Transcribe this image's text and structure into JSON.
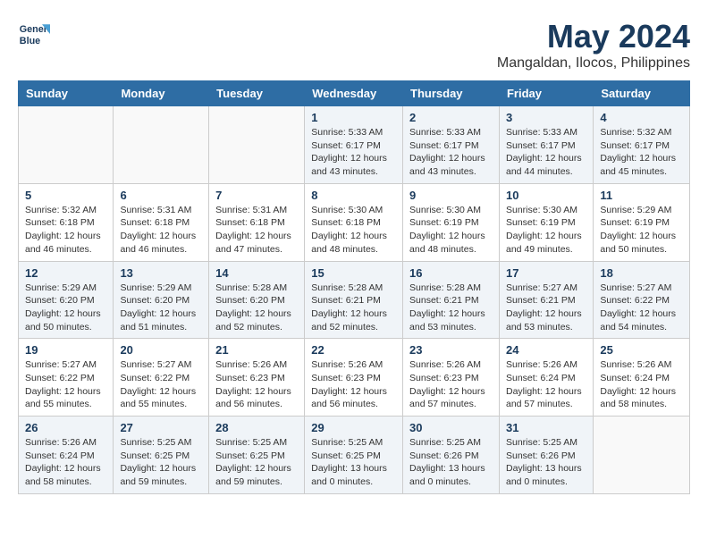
{
  "logo": {
    "line1": "General",
    "line2": "Blue"
  },
  "title": "May 2024",
  "location": "Mangaldan, Ilocos, Philippines",
  "weekdays": [
    "Sunday",
    "Monday",
    "Tuesday",
    "Wednesday",
    "Thursday",
    "Friday",
    "Saturday"
  ],
  "weeks": [
    [
      {
        "day": "",
        "info": ""
      },
      {
        "day": "",
        "info": ""
      },
      {
        "day": "",
        "info": ""
      },
      {
        "day": "1",
        "info": "Sunrise: 5:33 AM\nSunset: 6:17 PM\nDaylight: 12 hours\nand 43 minutes."
      },
      {
        "day": "2",
        "info": "Sunrise: 5:33 AM\nSunset: 6:17 PM\nDaylight: 12 hours\nand 43 minutes."
      },
      {
        "day": "3",
        "info": "Sunrise: 5:33 AM\nSunset: 6:17 PM\nDaylight: 12 hours\nand 44 minutes."
      },
      {
        "day": "4",
        "info": "Sunrise: 5:32 AM\nSunset: 6:17 PM\nDaylight: 12 hours\nand 45 minutes."
      }
    ],
    [
      {
        "day": "5",
        "info": "Sunrise: 5:32 AM\nSunset: 6:18 PM\nDaylight: 12 hours\nand 46 minutes."
      },
      {
        "day": "6",
        "info": "Sunrise: 5:31 AM\nSunset: 6:18 PM\nDaylight: 12 hours\nand 46 minutes."
      },
      {
        "day": "7",
        "info": "Sunrise: 5:31 AM\nSunset: 6:18 PM\nDaylight: 12 hours\nand 47 minutes."
      },
      {
        "day": "8",
        "info": "Sunrise: 5:30 AM\nSunset: 6:18 PM\nDaylight: 12 hours\nand 48 minutes."
      },
      {
        "day": "9",
        "info": "Sunrise: 5:30 AM\nSunset: 6:19 PM\nDaylight: 12 hours\nand 48 minutes."
      },
      {
        "day": "10",
        "info": "Sunrise: 5:30 AM\nSunset: 6:19 PM\nDaylight: 12 hours\nand 49 minutes."
      },
      {
        "day": "11",
        "info": "Sunrise: 5:29 AM\nSunset: 6:19 PM\nDaylight: 12 hours\nand 50 minutes."
      }
    ],
    [
      {
        "day": "12",
        "info": "Sunrise: 5:29 AM\nSunset: 6:20 PM\nDaylight: 12 hours\nand 50 minutes."
      },
      {
        "day": "13",
        "info": "Sunrise: 5:29 AM\nSunset: 6:20 PM\nDaylight: 12 hours\nand 51 minutes."
      },
      {
        "day": "14",
        "info": "Sunrise: 5:28 AM\nSunset: 6:20 PM\nDaylight: 12 hours\nand 52 minutes."
      },
      {
        "day": "15",
        "info": "Sunrise: 5:28 AM\nSunset: 6:21 PM\nDaylight: 12 hours\nand 52 minutes."
      },
      {
        "day": "16",
        "info": "Sunrise: 5:28 AM\nSunset: 6:21 PM\nDaylight: 12 hours\nand 53 minutes."
      },
      {
        "day": "17",
        "info": "Sunrise: 5:27 AM\nSunset: 6:21 PM\nDaylight: 12 hours\nand 53 minutes."
      },
      {
        "day": "18",
        "info": "Sunrise: 5:27 AM\nSunset: 6:22 PM\nDaylight: 12 hours\nand 54 minutes."
      }
    ],
    [
      {
        "day": "19",
        "info": "Sunrise: 5:27 AM\nSunset: 6:22 PM\nDaylight: 12 hours\nand 55 minutes."
      },
      {
        "day": "20",
        "info": "Sunrise: 5:27 AM\nSunset: 6:22 PM\nDaylight: 12 hours\nand 55 minutes."
      },
      {
        "day": "21",
        "info": "Sunrise: 5:26 AM\nSunset: 6:23 PM\nDaylight: 12 hours\nand 56 minutes."
      },
      {
        "day": "22",
        "info": "Sunrise: 5:26 AM\nSunset: 6:23 PM\nDaylight: 12 hours\nand 56 minutes."
      },
      {
        "day": "23",
        "info": "Sunrise: 5:26 AM\nSunset: 6:23 PM\nDaylight: 12 hours\nand 57 minutes."
      },
      {
        "day": "24",
        "info": "Sunrise: 5:26 AM\nSunset: 6:24 PM\nDaylight: 12 hours\nand 57 minutes."
      },
      {
        "day": "25",
        "info": "Sunrise: 5:26 AM\nSunset: 6:24 PM\nDaylight: 12 hours\nand 58 minutes."
      }
    ],
    [
      {
        "day": "26",
        "info": "Sunrise: 5:26 AM\nSunset: 6:24 PM\nDaylight: 12 hours\nand 58 minutes."
      },
      {
        "day": "27",
        "info": "Sunrise: 5:25 AM\nSunset: 6:25 PM\nDaylight: 12 hours\nand 59 minutes."
      },
      {
        "day": "28",
        "info": "Sunrise: 5:25 AM\nSunset: 6:25 PM\nDaylight: 12 hours\nand 59 minutes."
      },
      {
        "day": "29",
        "info": "Sunrise: 5:25 AM\nSunset: 6:25 PM\nDaylight: 13 hours\nand 0 minutes."
      },
      {
        "day": "30",
        "info": "Sunrise: 5:25 AM\nSunset: 6:26 PM\nDaylight: 13 hours\nand 0 minutes."
      },
      {
        "day": "31",
        "info": "Sunrise: 5:25 AM\nSunset: 6:26 PM\nDaylight: 13 hours\nand 0 minutes."
      },
      {
        "day": "",
        "info": ""
      }
    ]
  ]
}
